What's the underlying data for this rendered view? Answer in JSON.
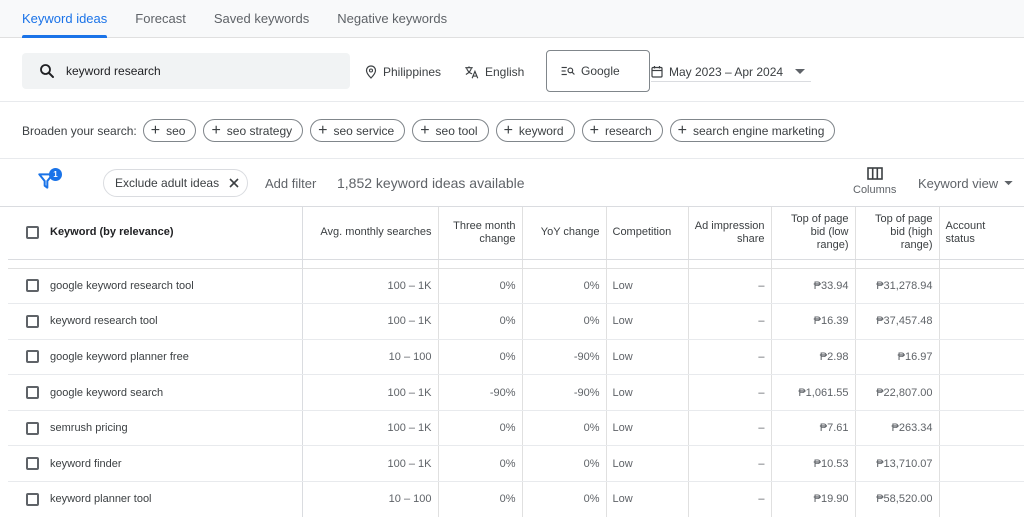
{
  "tabs": [
    {
      "label": "Keyword ideas"
    },
    {
      "label": "Forecast"
    },
    {
      "label": "Saved keywords"
    },
    {
      "label": "Negative keywords"
    }
  ],
  "search": {
    "value": "keyword research"
  },
  "location": "Philippines",
  "language": "English",
  "search_engine": "Google",
  "date_range": "May 2023 – Apr 2024",
  "broaden": {
    "label": "Broaden your search:",
    "chips": [
      "seo",
      "seo strategy",
      "seo service",
      "seo tool",
      "keyword",
      "research",
      "search engine marketing"
    ]
  },
  "filters": {
    "badge": "1",
    "exclude_chip": "Exclude adult ideas",
    "add_filter": "Add filter",
    "ideas_count": "1,852 keyword ideas available",
    "columns_label": "Columns",
    "view_label": "Keyword view"
  },
  "table": {
    "headers": {
      "keyword": "Keyword (by relevance)",
      "avg": "Avg. monthly searches",
      "three_month": "Three month change",
      "yoy": "YoY change",
      "competition": "Competition",
      "ad_share": "Ad impression share",
      "bid_low": "Top of page bid (low range)",
      "bid_high": "Top of page bid (high range)",
      "account": "Account status"
    },
    "rows": [
      {
        "keyword": "google keyword research tool",
        "avg": "100 – 1K",
        "three_month": "0%",
        "yoy": "0%",
        "competition": "Low",
        "ad_share": "–",
        "bid_low": "₱33.94",
        "bid_high": "₱31,278.94"
      },
      {
        "keyword": "keyword research tool",
        "avg": "100 – 1K",
        "three_month": "0%",
        "yoy": "0%",
        "competition": "Low",
        "ad_share": "–",
        "bid_low": "₱16.39",
        "bid_high": "₱37,457.48"
      },
      {
        "keyword": "google keyword planner free",
        "avg": "10 – 100",
        "three_month": "0%",
        "yoy": "-90%",
        "competition": "Low",
        "ad_share": "–",
        "bid_low": "₱2.98",
        "bid_high": "₱16.97"
      },
      {
        "keyword": "google keyword search",
        "avg": "100 – 1K",
        "three_month": "-90%",
        "yoy": "-90%",
        "competition": "Low",
        "ad_share": "–",
        "bid_low": "₱1,061.55",
        "bid_high": "₱22,807.00"
      },
      {
        "keyword": "semrush pricing",
        "avg": "100 – 1K",
        "three_month": "0%",
        "yoy": "0%",
        "competition": "Low",
        "ad_share": "–",
        "bid_low": "₱7.61",
        "bid_high": "₱263.34"
      },
      {
        "keyword": "keyword finder",
        "avg": "100 – 1K",
        "three_month": "0%",
        "yoy": "0%",
        "competition": "Low",
        "ad_share": "–",
        "bid_low": "₱10.53",
        "bid_high": "₱13,710.07"
      },
      {
        "keyword": "keyword planner tool",
        "avg": "10 – 100",
        "three_month": "0%",
        "yoy": "0%",
        "competition": "Low",
        "ad_share": "–",
        "bid_low": "₱19.90",
        "bid_high": "₱58,520.00"
      }
    ]
  },
  "colors": {
    "accent": "#1a73e8",
    "text": "#3c4043",
    "muted": "#5f6368"
  }
}
